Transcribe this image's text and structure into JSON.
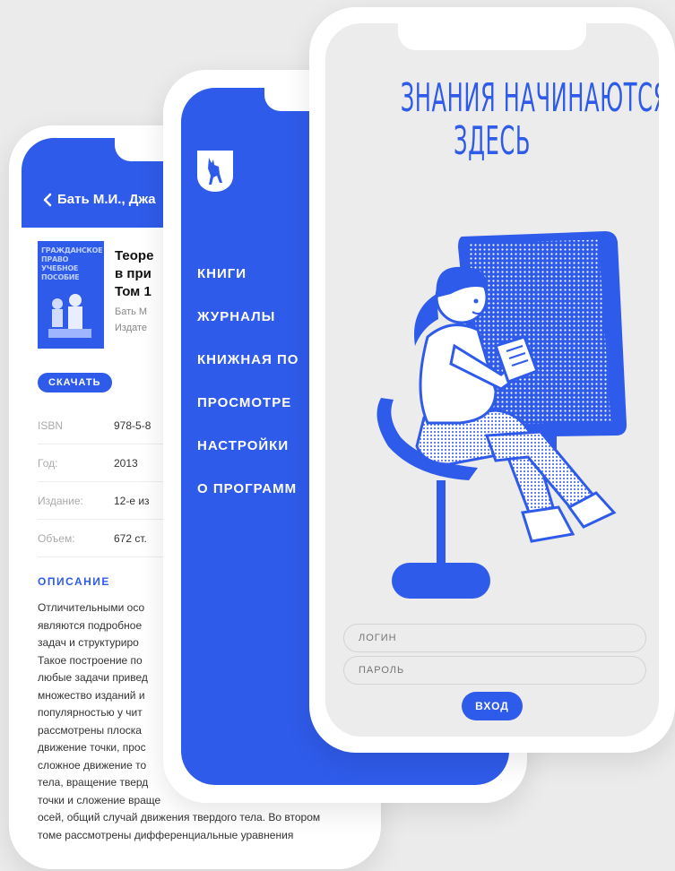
{
  "colors": {
    "accent": "#2f5bea",
    "background": "#ebebeb"
  },
  "book_screen": {
    "back_label": "Бать М.И., Джа",
    "cover_title": "ГРАЖДАНСКОЕ ПРАВО УЧЕБНОЕ ПОСОБИЕ",
    "title_lines": [
      "Теорe",
      "в при",
      "Том 1"
    ],
    "author_line": "Бать М",
    "publisher_line": "Издате",
    "download_label": "СКАЧАТЬ",
    "details": [
      {
        "key": "ISBN",
        "value": "978-5-8"
      },
      {
        "key": "Год:",
        "value": "2013"
      },
      {
        "key": "Издание:",
        "value": "12-е из"
      },
      {
        "key": "Объем:",
        "value": "672 ст."
      }
    ],
    "description_heading": "ОПИСАНИЕ",
    "description_lines": [
      "Отличительными осо",
      "являются подробное",
      "задач и структуриро",
      "Такое построение по",
      "любые задачи привед",
      "множество изданий и",
      "популярностью у чит",
      "рассмотрены плоска",
      "движение точки, прос",
      "сложное движение то",
      "тела, вращение тверд",
      "точки и сложение враще",
      "осей, общий случай движения твердого тела. Во втором",
      "томе рассмотрены дифференциальные уравнения"
    ]
  },
  "menu_screen": {
    "logo_icon": "deer-shield-icon",
    "items": [
      "КНИГИ",
      "ЖУРНАЛЫ",
      "КНИЖНАЯ ПО",
      "ПРОСМОТРЕ",
      "НАСТРОЙКИ",
      "О ПРОГРАММ"
    ]
  },
  "login_screen": {
    "headline_line1": "ЗНАНИЯ НАЧИНАЮТСЯ",
    "headline_line2": "ЗДЕСЬ",
    "login_placeholder": "ЛОГИН",
    "password_placeholder": "ПАРОЛЬ",
    "enter_label": "ВХОД"
  }
}
